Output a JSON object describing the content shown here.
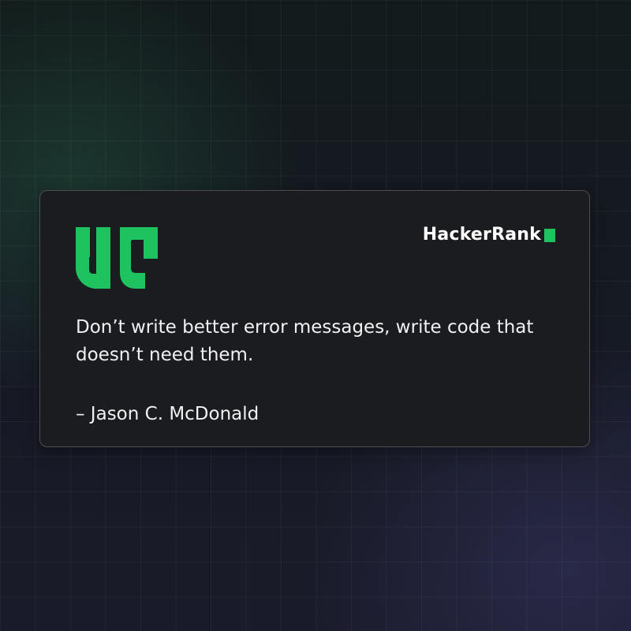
{
  "brand": {
    "name": "HackerRank",
    "accent_color": "#1ec25f"
  },
  "quote": {
    "icon": "opening-quote-icon",
    "text": "Don’t write better error messages, write code that doesn’t need them.",
    "author": "– Jason C. McDonald"
  },
  "colors": {
    "background": "#141821",
    "card": "#1b1c20",
    "text": "#f1f1f3",
    "accent": "#1ec25f"
  }
}
